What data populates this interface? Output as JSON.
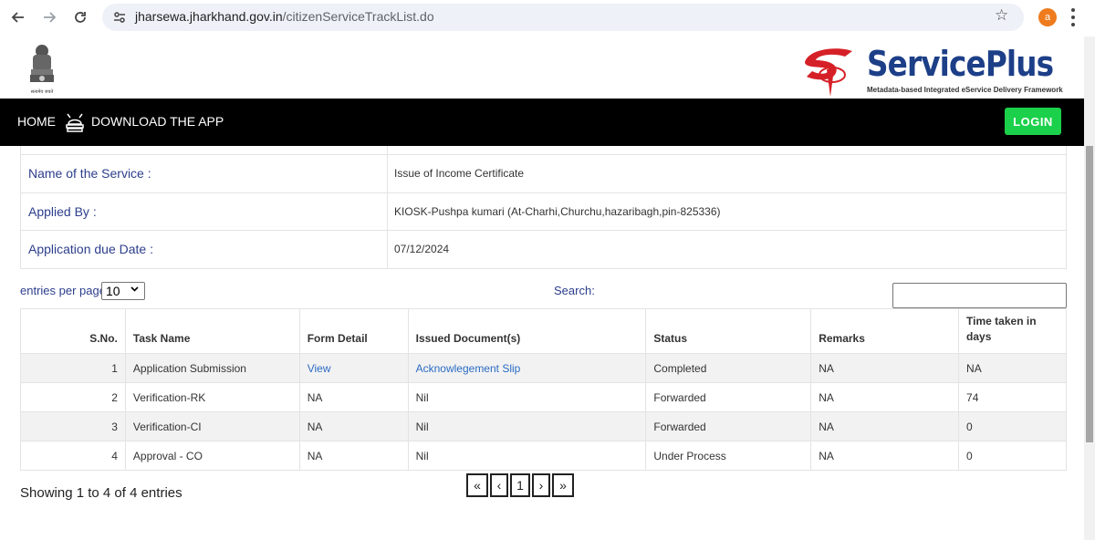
{
  "browser": {
    "url_host": "jharsewa.jharkhand.gov.in",
    "url_path": "/citizenServiceTrackList.do",
    "avatar_letter": "a"
  },
  "header": {
    "emblem_caption": "सत्यमेव जयते",
    "brand_name": "ServicePlus",
    "brand_tagline": "Metadata-based Integrated eService Delivery Framework"
  },
  "navbar": {
    "home": "HOME",
    "download": "DOWNLOAD THE APP",
    "login": "LOGIN"
  },
  "info": [
    {
      "label": "Name of the Service :",
      "value": "Issue of Income Certificate"
    },
    {
      "label": "Applied By :",
      "value": "KIOSK-Pushpa kumari (At-Charhi,Churchu,hazaribagh,pin-825336)"
    },
    {
      "label": "Application due Date :",
      "value": "07/12/2024"
    }
  ],
  "controls": {
    "entries_label": "entries per page",
    "entries_value": "10",
    "search_label": "Search:",
    "search_value": ""
  },
  "table": {
    "headers": [
      "S.No.",
      "Task Name",
      "Form Detail",
      "Issued Document(s)",
      "Status",
      "Remarks",
      "Time taken in days"
    ],
    "rows": [
      {
        "sno": "1",
        "task": "Application Submission",
        "form": "View",
        "doc": "Acknowlegement Slip",
        "status": "Completed",
        "remarks": "NA",
        "time": "NA"
      },
      {
        "sno": "2",
        "task": "Verification-RK",
        "form": "NA",
        "doc": "Nil",
        "status": "Forwarded",
        "remarks": "NA",
        "time": "74"
      },
      {
        "sno": "3",
        "task": "Verification-CI",
        "form": "NA",
        "doc": "Nil",
        "status": "Forwarded",
        "remarks": "NA",
        "time": "0"
      },
      {
        "sno": "4",
        "task": "Approval - CO",
        "form": "NA",
        "doc": "Nil",
        "status": "Under Process",
        "remarks": "NA",
        "time": "0"
      }
    ]
  },
  "footer": {
    "showing": "Showing 1 to 4 of 4 entries",
    "pager": {
      "first": "«",
      "prev": "‹",
      "page": "1",
      "next": "›",
      "last": "»"
    }
  },
  "colors": {
    "navbar_bg": "#000000",
    "login_bg": "#1bd04a",
    "label_text": "#2c3e8c",
    "link": "#2b6cc4",
    "brand": "#1d3f88",
    "brand_accent": "#d62027"
  }
}
